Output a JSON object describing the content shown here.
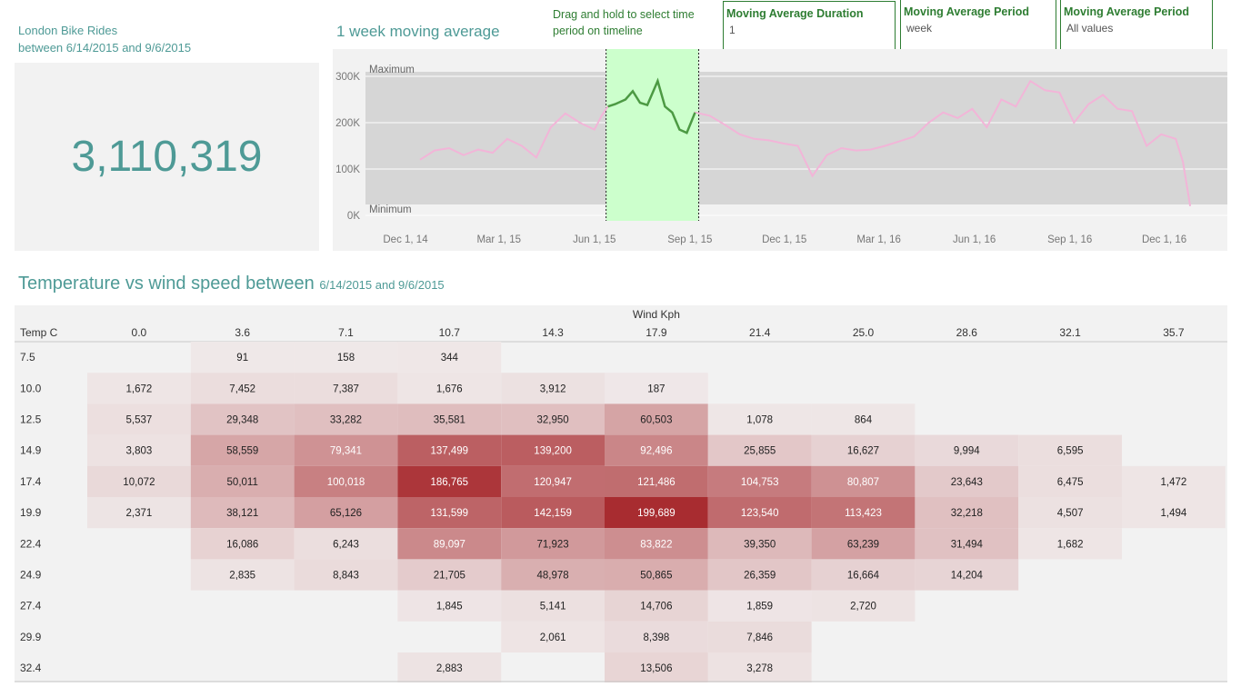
{
  "kpi": {
    "title_line1": "London Bike Rides",
    "title_line2": "between 6/14/2015 and 9/6/2015",
    "value": "3,110,319"
  },
  "timeline": {
    "title": "1 week moving average",
    "instruction": "Drag and hold to select time period on timeline",
    "band_max_label": "Maximum",
    "band_min_label": "Minimum",
    "y_ticks": [
      "300K",
      "200K",
      "100K",
      "0K"
    ],
    "x_ticks": [
      "Dec 1, 14",
      "Mar 1, 15",
      "Jun 1, 15",
      "Sep 1, 15",
      "Dec 1, 15",
      "Mar 1, 16",
      "Jun 1, 16",
      "Sep 1, 16",
      "Dec 1, 16"
    ]
  },
  "filters": [
    {
      "label": "Moving Average Duration",
      "value": "1"
    },
    {
      "label": "Moving Average Period",
      "value": "week"
    },
    {
      "label": "Moving Average Period",
      "value": "All values"
    }
  ],
  "heatmap_title": {
    "main": "Temperature vs wind speed between",
    "sub": "6/14/2015 and 9/6/2015"
  },
  "colors": {
    "teal": "#4e9a96",
    "selection_green": "#2e7d32",
    "selection_fill": "#ccffcc",
    "line_pink": "#f2b5d8",
    "line_green": "#4c9a43",
    "heat_max": "#a82c30"
  },
  "chart_data": [
    {
      "type": "line",
      "title": "1 week moving average",
      "ylim": [
        0,
        300000
      ],
      "x_start": "2014-12-01",
      "x_end": "2017-01-01",
      "selected_range": [
        "2015-06-14",
        "2015-09-06"
      ],
      "series": [
        {
          "values": [
            [
              "2014-12-15",
              120000
            ],
            [
              "2014-12-29",
              140000
            ],
            [
              "2015-01-12",
              145000
            ],
            [
              "2015-01-26",
              130000
            ],
            [
              "2015-02-09",
              142000
            ],
            [
              "2015-02-23",
              135000
            ],
            [
              "2015-03-09",
              165000
            ],
            [
              "2015-03-23",
              150000
            ],
            [
              "2015-04-06",
              125000
            ],
            [
              "2015-04-20",
              190000
            ],
            [
              "2015-05-04",
              220000
            ],
            [
              "2015-05-18",
              200000
            ],
            [
              "2015-06-01",
              185000
            ],
            [
              "2015-06-08",
              215000
            ],
            [
              "2015-06-14",
              235000
            ],
            [
              "2015-06-21",
              240000
            ],
            [
              "2015-07-01",
              250000
            ],
            [
              "2015-07-08",
              268000
            ],
            [
              "2015-07-15",
              243000
            ],
            [
              "2015-07-22",
              238000
            ],
            [
              "2015-08-01",
              290000
            ],
            [
              "2015-08-08",
              235000
            ],
            [
              "2015-08-15",
              222000
            ],
            [
              "2015-08-22",
              185000
            ],
            [
              "2015-08-29",
              178000
            ],
            [
              "2015-09-06",
              222000
            ],
            [
              "2015-09-20",
              215000
            ],
            [
              "2015-10-05",
              195000
            ],
            [
              "2015-10-19",
              175000
            ],
            [
              "2015-11-02",
              165000
            ],
            [
              "2015-11-16",
              162000
            ],
            [
              "2015-11-30",
              155000
            ],
            [
              "2015-12-14",
              150000
            ],
            [
              "2015-12-28",
              85000
            ],
            [
              "2016-01-11",
              130000
            ],
            [
              "2016-01-25",
              145000
            ],
            [
              "2016-02-08",
              140000
            ],
            [
              "2016-02-22",
              142000
            ],
            [
              "2016-03-07",
              150000
            ],
            [
              "2016-03-21",
              160000
            ],
            [
              "2016-04-04",
              170000
            ],
            [
              "2016-04-18",
              200000
            ],
            [
              "2016-05-02",
              222000
            ],
            [
              "2016-05-16",
              210000
            ],
            [
              "2016-05-30",
              230000
            ],
            [
              "2016-06-13",
              190000
            ],
            [
              "2016-06-27",
              250000
            ],
            [
              "2016-07-11",
              235000
            ],
            [
              "2016-07-25",
              290000
            ],
            [
              "2016-08-08",
              270000
            ],
            [
              "2016-08-22",
              265000
            ],
            [
              "2016-09-05",
              200000
            ],
            [
              "2016-09-19",
              240000
            ],
            [
              "2016-10-03",
              260000
            ],
            [
              "2016-10-17",
              230000
            ],
            [
              "2016-10-31",
              225000
            ],
            [
              "2016-11-14",
              150000
            ],
            [
              "2016-11-28",
              175000
            ],
            [
              "2016-12-12",
              165000
            ],
            [
              "2016-12-19",
              115000
            ],
            [
              "2016-12-26",
              20000
            ]
          ]
        }
      ]
    },
    {
      "type": "heatmap",
      "title": "Temperature vs wind speed between 6/14/2015 and 9/6/2015",
      "xlabel": "Wind Kph",
      "ylabel": "Temp C",
      "x": [
        "0.0",
        "3.6",
        "7.1",
        "10.7",
        "14.3",
        "17.9",
        "21.4",
        "25.0",
        "28.6",
        "32.1",
        "35.7"
      ],
      "y": [
        "7.5",
        "10.0",
        "12.5",
        "14.9",
        "17.4",
        "19.9",
        "22.4",
        "24.9",
        "27.4",
        "29.9",
        "32.4"
      ],
      "max": 199689,
      "values": [
        [
          null,
          91,
          158,
          344,
          null,
          null,
          null,
          null,
          null,
          null,
          null
        ],
        [
          1672,
          7452,
          7387,
          1676,
          3912,
          187,
          null,
          null,
          null,
          null,
          null
        ],
        [
          5537,
          29348,
          33282,
          35581,
          32950,
          60503,
          1078,
          864,
          null,
          null,
          null
        ],
        [
          3803,
          58559,
          79341,
          137499,
          139200,
          92496,
          25855,
          16627,
          9994,
          6595,
          null
        ],
        [
          10072,
          50011,
          100018,
          186765,
          120947,
          121486,
          104753,
          80807,
          23643,
          6475,
          1472
        ],
        [
          2371,
          38121,
          65126,
          131599,
          142159,
          199689,
          123540,
          113423,
          32218,
          4507,
          1494
        ],
        [
          null,
          16086,
          6243,
          89097,
          71923,
          83822,
          39350,
          63239,
          31494,
          1682,
          null
        ],
        [
          null,
          2835,
          8843,
          21705,
          48978,
          50865,
          26359,
          16664,
          14204,
          null,
          null
        ],
        [
          null,
          null,
          null,
          1845,
          5141,
          14706,
          1859,
          2720,
          null,
          null,
          null
        ],
        [
          null,
          null,
          null,
          null,
          2061,
          8398,
          7846,
          null,
          null,
          null,
          null
        ],
        [
          null,
          null,
          null,
          2883,
          null,
          13506,
          3278,
          null,
          null,
          null,
          null
        ]
      ]
    }
  ]
}
